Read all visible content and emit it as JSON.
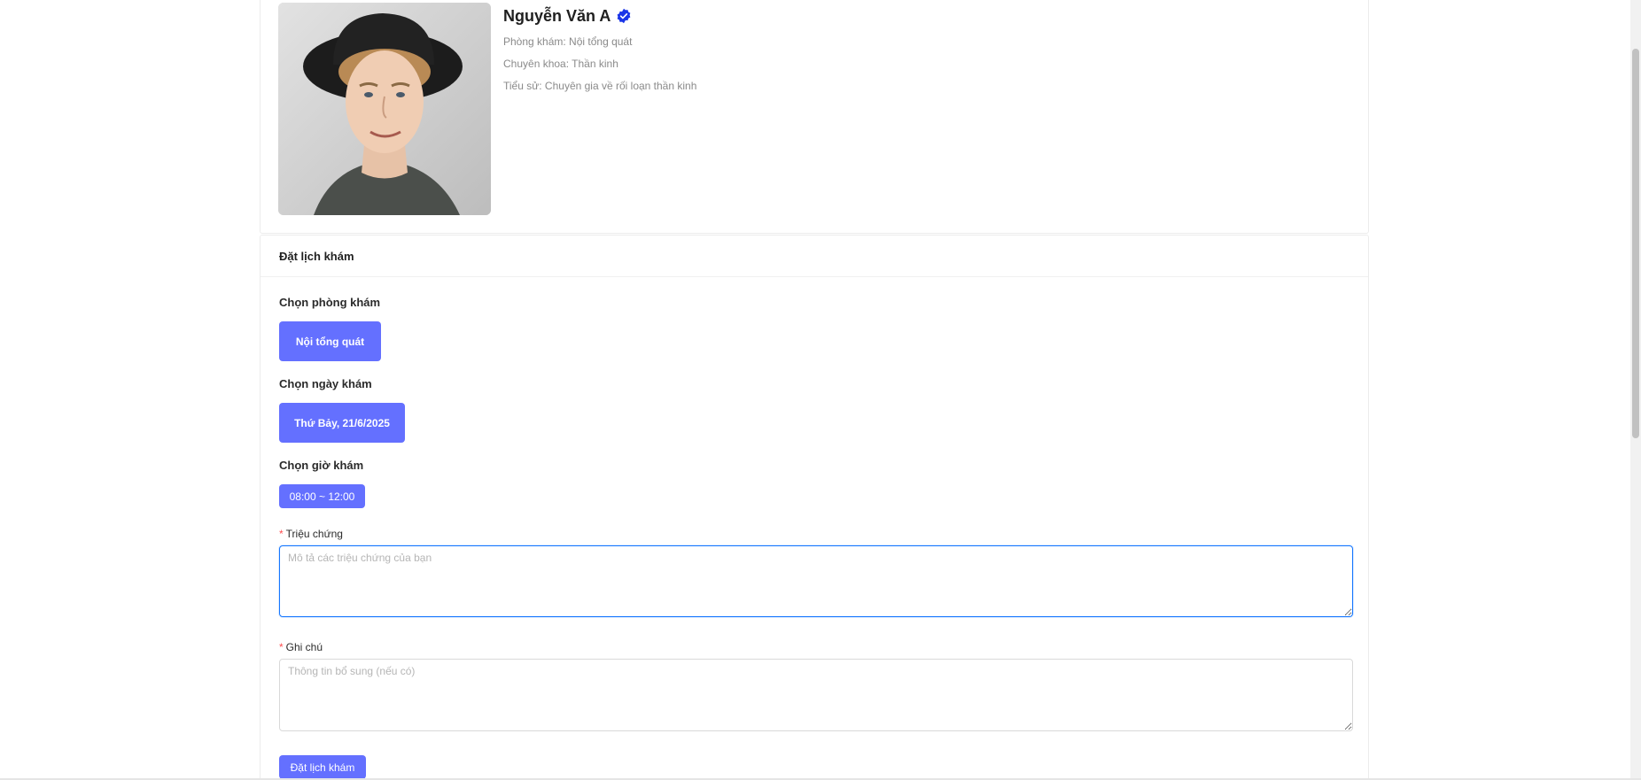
{
  "doctor": {
    "name": "Nguyễn Văn A",
    "clinic_line": "Phòng khám: Nội tổng quát",
    "specialty_line": "Chuyên khoa: Thần kinh",
    "bio_line": "Tiểu sử: Chuyên gia về rối loạn thần kinh",
    "verified_icon": "verified-check-icon",
    "verified_color": "#1a35e8"
  },
  "booking": {
    "header": "Đặt lịch khám",
    "clinic_section_label": "Chọn phòng khám",
    "clinic_option": "Nội tổng quát",
    "date_section_label": "Chọn ngày khám",
    "date_option": "Thứ Bảy, 21/6/2025",
    "time_section_label": "Chọn giờ khám",
    "time_option": "08:00 ~ 12:00",
    "symptoms_label": "Triệu chứng",
    "symptoms_placeholder": "Mô tả các triệu chứng của bạn",
    "symptoms_value": "",
    "notes_label": "Ghi chú",
    "notes_placeholder": "Thông tin bổ sung (nếu có)",
    "notes_value": "",
    "required_mark": "*",
    "submit_label": "Đặt lịch khám"
  },
  "colors": {
    "accent": "#6470ff",
    "focus_border": "#1677ff",
    "required": "#ff4d4f"
  }
}
